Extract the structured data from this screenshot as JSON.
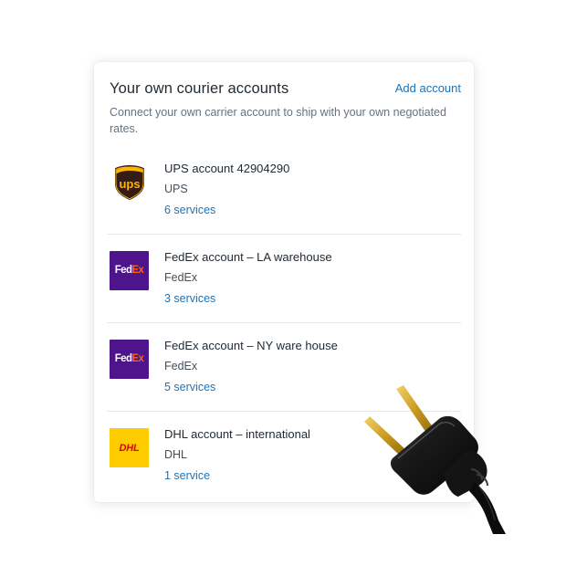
{
  "panel": {
    "title": "Your own courier accounts",
    "add_label": "Add account",
    "description": "Connect your own carrier account to ship with your own negotiated rates."
  },
  "accounts": [
    {
      "logo": "ups-logo",
      "name": "UPS account 42904290",
      "carrier": "UPS",
      "services": "6 services"
    },
    {
      "logo": "fedex-logo",
      "name": "FedEx account – LA warehouse",
      "carrier": "FedEx",
      "services": "3 services"
    },
    {
      "logo": "fedex-logo",
      "name": "FedEx account – NY ware house",
      "carrier": "FedEx",
      "services": "5 services"
    },
    {
      "logo": "dhl-logo",
      "name": "DHL account – international",
      "carrier": "DHL",
      "services": "1 service"
    }
  ],
  "logos": {
    "ups_text": "ups",
    "fedex_fed": "Fed",
    "fedex_ex": "Ex",
    "dhl_text": "DHL"
  },
  "colors": {
    "link": "#1f73b7",
    "ups_brown": "#351c15",
    "ups_gold": "#ffb500",
    "fedex_purple": "#4d148c",
    "fedex_orange": "#ff6200",
    "dhl_yellow": "#ffcc00",
    "dhl_red": "#d40511"
  },
  "decoration": {
    "image": "power-plug"
  }
}
